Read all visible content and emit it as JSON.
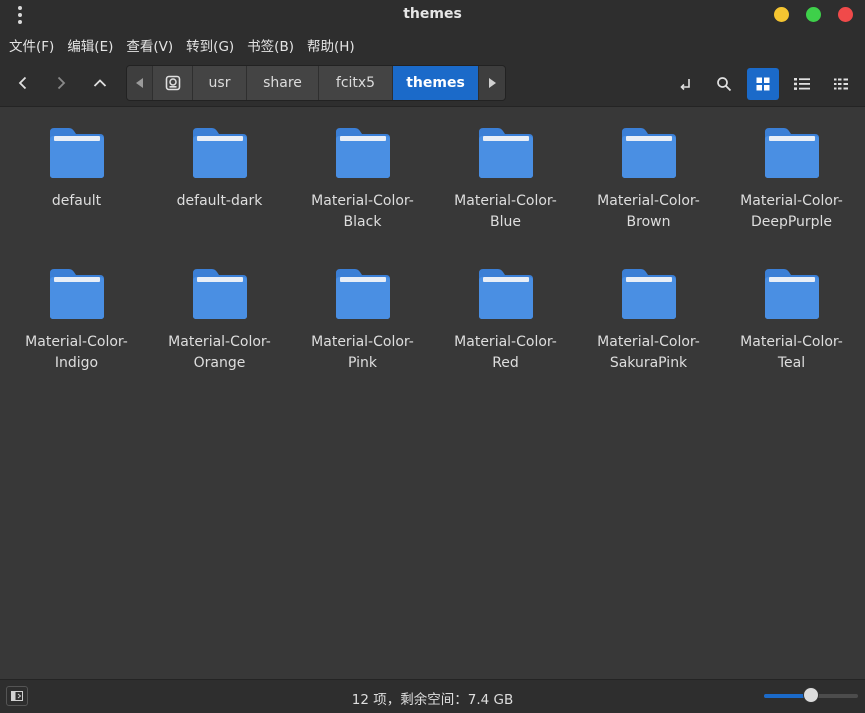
{
  "window": {
    "title": "themes",
    "controls": [
      {
        "name": "minimize",
        "color": "#f5c531"
      },
      {
        "name": "maximize",
        "color": "#3ed04a"
      },
      {
        "name": "close",
        "color": "#f04a4a"
      }
    ]
  },
  "menu": {
    "items": [
      "文件(F)",
      "编辑(E)",
      "查看(V)",
      "转到(G)",
      "书签(B)",
      "帮助(H)"
    ]
  },
  "toolbar": {
    "icons": {
      "back": "chevron-left-icon",
      "forward": "chevron-right-icon",
      "up": "chevron-up-icon",
      "open_terminal": "enter-icon",
      "search": "search-icon",
      "icon_view": "grid-icon",
      "list_view": "list-icon",
      "compact_view": "compact-list-icon"
    },
    "active_view": "icon_view",
    "accent": "#1b6ac9"
  },
  "breadcrumbs": {
    "segments": [
      "usr",
      "share",
      "fcitx5",
      "themes"
    ],
    "active_index": 3,
    "root_icon": "disk-icon"
  },
  "files": [
    {
      "line1": "default",
      "line2": ""
    },
    {
      "line1": "default-dark",
      "line2": ""
    },
    {
      "line1": "Material-Color-",
      "line2": "Black"
    },
    {
      "line1": "Material-Color-",
      "line2": "Blue"
    },
    {
      "line1": "Material-Color-",
      "line2": "Brown"
    },
    {
      "line1": "Material-Color-",
      "line2": "DeepPurple"
    },
    {
      "line1": "Material-Color-",
      "line2": "Indigo"
    },
    {
      "line1": "Material-Color-",
      "line2": "Orange"
    },
    {
      "line1": "Material-Color-",
      "line2": "Pink"
    },
    {
      "line1": "Material-Color-",
      "line2": "Red"
    },
    {
      "line1": "Material-Color-",
      "line2": "SakuraPink"
    },
    {
      "line1": "Material-Color-",
      "line2": "Teal"
    }
  ],
  "folder_colors": {
    "body": "#4a8fe3",
    "tab": "#3b7fd6",
    "paper": "#e8eef7"
  },
  "status": {
    "text": "12 项，剩余空间：7.4 GB",
    "zoom_level": 0.5
  }
}
